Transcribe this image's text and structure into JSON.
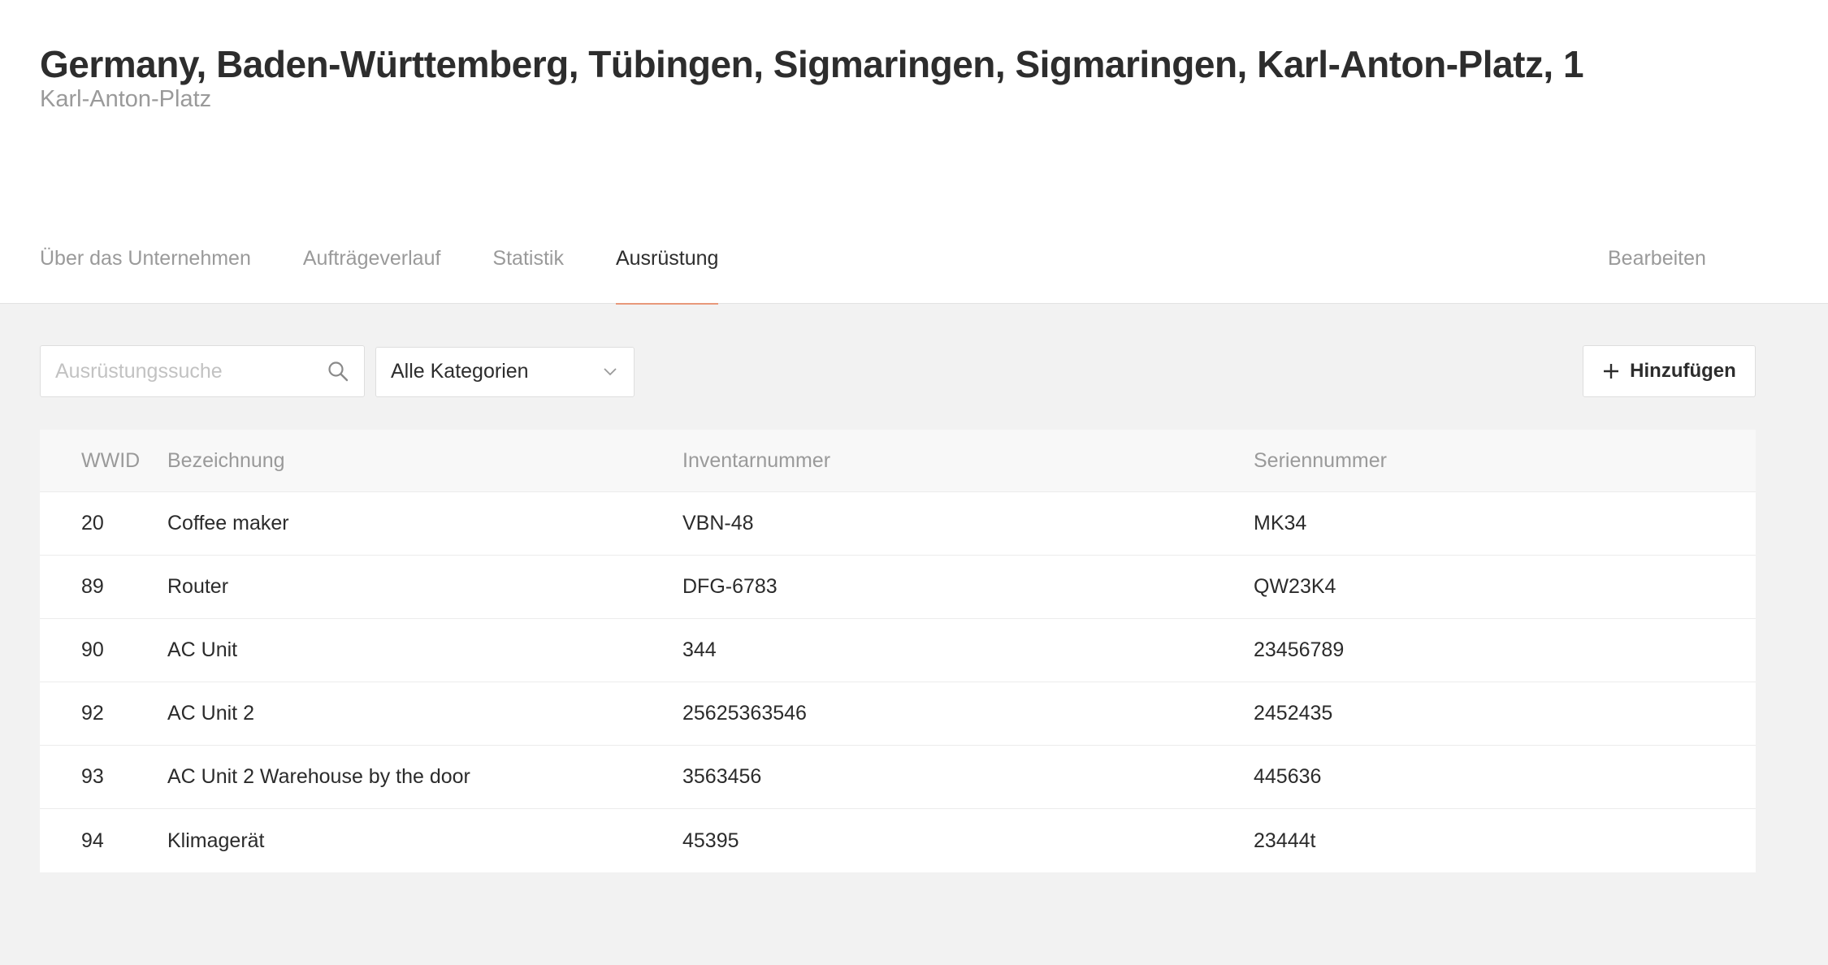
{
  "header": {
    "title": "Germany, Baden-Württemberg, Tübingen, Sigmaringen, Sigmaringen, Karl-Anton-Platz, 1",
    "subtitle": "Karl-Anton-Platz"
  },
  "tabs": [
    {
      "label": "Über das Unternehmen",
      "active": false
    },
    {
      "label": "Aufträgeverlauf",
      "active": false
    },
    {
      "label": "Statistik",
      "active": false
    },
    {
      "label": "Ausrüstung",
      "active": true
    }
  ],
  "edit_label": "Bearbeiten",
  "toolbar": {
    "search_placeholder": "Ausrüstungssuche",
    "search_value": "",
    "category_selected": "Alle Kategorien",
    "add_label": "Hinzufügen"
  },
  "table": {
    "columns": [
      "WWID",
      "Bezeichnung",
      "Inventarnummer",
      "Seriennummer"
    ],
    "rows": [
      {
        "wwid": "20",
        "name": "Coffee maker",
        "inventory": "VBN-48",
        "serial": "MK34"
      },
      {
        "wwid": "89",
        "name": "Router",
        "inventory": "DFG-6783",
        "serial": "QW23K4"
      },
      {
        "wwid": "90",
        "name": "AC Unit",
        "inventory": "344",
        "serial": "23456789"
      },
      {
        "wwid": "92",
        "name": "AC Unit 2",
        "inventory": "25625363546",
        "serial": "2452435"
      },
      {
        "wwid": "93",
        "name": "AC Unit 2 Warehouse by the door",
        "inventory": "3563456",
        "serial": "445636"
      },
      {
        "wwid": "94",
        "name": "Klimagerät",
        "inventory": "45395",
        "serial": "23444t"
      }
    ]
  },
  "icons": {
    "search": "search-icon",
    "dropdown": "chevron-down-icon",
    "add": "plus-icon"
  },
  "colors": {
    "active_tab_underline": "#e8987a",
    "header_background": "#ffffff",
    "page_background": "#f2f2f2"
  }
}
